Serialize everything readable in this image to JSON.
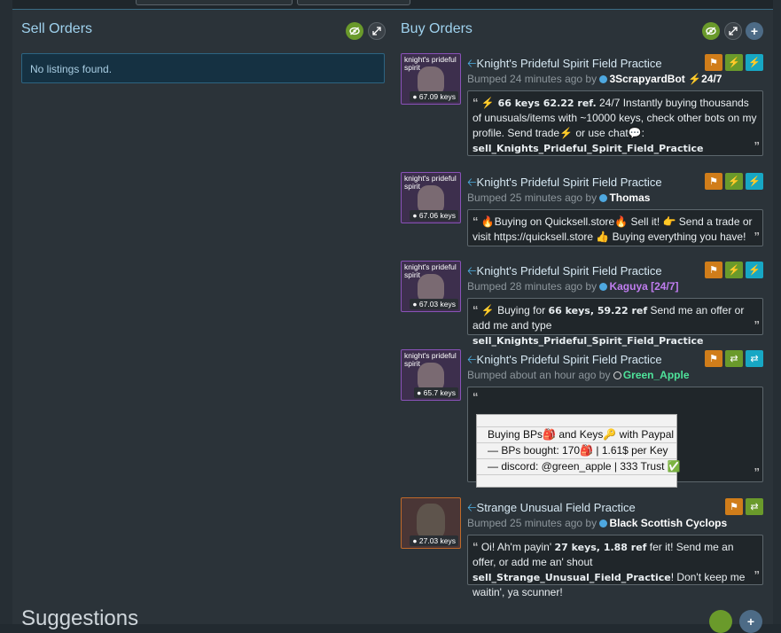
{
  "sections": {
    "sell_title": "Sell Orders",
    "buy_title": "Buy Orders",
    "suggestions_title": "Suggestions",
    "no_listings": "No listings found."
  },
  "icons": {
    "eye": "eye-slash-icon",
    "expand": "expand-icon",
    "plus": "plus-icon",
    "flag": "flag-icon",
    "bolt": "lightning-icon",
    "swap": "swap-arrows-icon"
  },
  "colors": {
    "accent_blue": "#4fb3e6",
    "flag_orange": "#d07d1a",
    "green": "#6a9a2b",
    "cyan": "#17a7c4",
    "unique_border": "#8a52b8",
    "strange_border": "#c06a2a",
    "kaguya": "#c07df0",
    "green_apple": "#4ee39a"
  },
  "orders": [
    {
      "item_label": "knight's prideful spirit",
      "price": "67.09 keys",
      "title": "Knight's Prideful Spirit Field Practice",
      "bump_prefix": "Bumped 24 minutes ago by",
      "user": "3ScrapyardBot",
      "user_suffix": "24/7",
      "msg_a": " 66 keys 62.22 ref.",
      "msg_b": " 24/7 Instantly buying thousands of unusuals/items with ~10000 keys, check other bots on my profile. Send  trade",
      "msg_c": " or  use  chat",
      "msg_d": ":",
      "msg_e": "sell_Knights_Prideful_Spirit_Field_Practice"
    },
    {
      "item_label": "knight's prideful spirit",
      "price": "67.06 keys",
      "title": "Knight's Prideful Spirit Field Practice",
      "bump_prefix": "Bumped 25 minutes ago by",
      "user": "Thomas",
      "msg_a": "Buying on Quicksell.store",
      "msg_b": " Sell it! ",
      "msg_c": " Send a trade or visit https://quicksell.store ",
      "msg_d": " Buying everything you have!"
    },
    {
      "item_label": "knight's prideful spirit",
      "price": "67.03 keys",
      "title": "Knight's Prideful Spirit Field Practice",
      "bump_prefix": "Bumped 28 minutes ago by",
      "user": "Kaguya [24/7]",
      "msg_a": " Buying for ",
      "msg_b": "66 keys, 59.22 ref",
      "msg_c": " Send me an offer or add me and type ",
      "msg_d": "sell_Knights_Prideful_Spirit_Field_Practice"
    },
    {
      "item_label": "knight's prideful spirit",
      "price": "65.7 keys",
      "title": "Knight's Prideful Spirit Field Practice",
      "bump_prefix": "Bumped about an hour ago by",
      "user": "Green_Apple",
      "rows": [
        "Buying BPs",
        " and Keys",
        " with Paypal",
        "— BPs bought: 170",
        " | 1.61$ per Key",
        "— discord: @green_apple | 333 Trust"
      ]
    },
    {
      "price": "27.03 keys",
      "title": "Strange Unusual Field Practice",
      "bump_prefix": "Bumped 25 minutes ago by",
      "user": "Black Scottish Cyclops",
      "msg_a": "Oi! Ah'm payin' ",
      "msg_b": "27 keys, 1.88 ref",
      "msg_c": " fer it! Send me an offer, or add me an' shout ",
      "msg_d": "sell_Strange_Unusual_Field_Practice",
      "msg_e": "! Don't keep me waitin', ya scunner!"
    }
  ]
}
